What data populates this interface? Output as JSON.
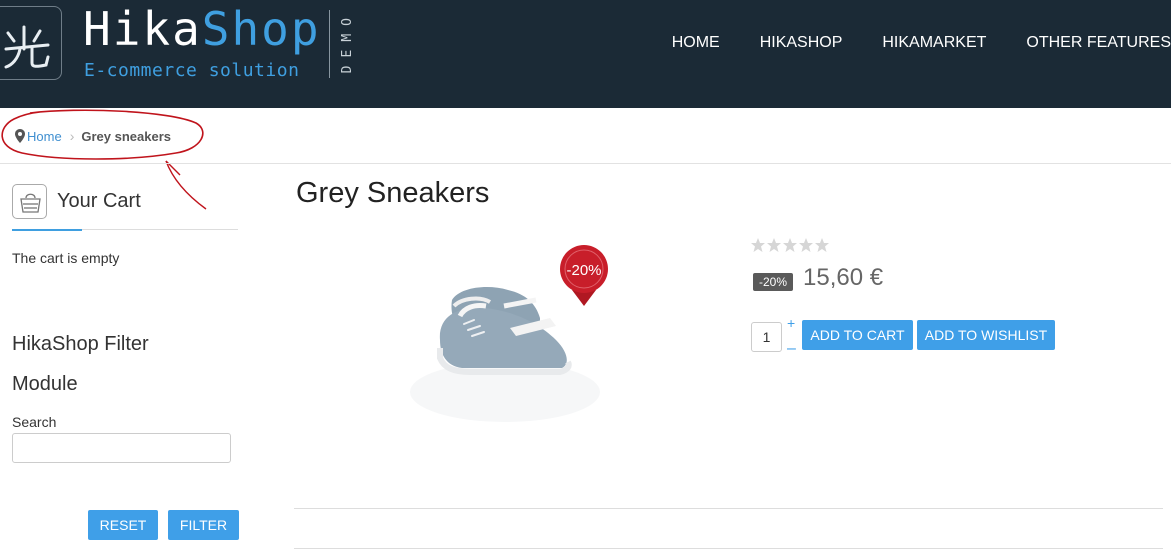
{
  "header": {
    "brand_part1": "Hika",
    "brand_part2": "Shop",
    "tagline": "E-commerce solution",
    "demo_label": "DEMO",
    "nav": [
      "HOME",
      "HIKASHOP",
      "HIKAMARKET",
      "OTHER FEATURES"
    ]
  },
  "breadcrumb": {
    "home": "Home",
    "current": "Grey sneakers"
  },
  "sidebar": {
    "cart_title": "Your Cart",
    "cart_empty": "The cart is empty",
    "filter_title": "HikaShop Filter Module",
    "search_label": "Search",
    "reset_label": "RESET",
    "filter_label": "FILTER"
  },
  "product": {
    "title": "Grey Sneakers",
    "image_badge": "-20%",
    "discount_badge": "-20%",
    "price": "15,60 €",
    "quantity": "1",
    "qty_plus": "+",
    "qty_minus": "–",
    "add_to_cart": "ADD TO CART",
    "add_to_wishlist": "ADD TO WISHLIST",
    "rating_stars": 5,
    "rating_filled": 0
  },
  "colors": {
    "header_bg": "#1b2a36",
    "accent": "#3f9fe0",
    "button": "#3f9fe8",
    "sale_badge": "#c81e2a",
    "annotation": "#c0141c"
  },
  "icons": [
    "hikashop-logo-icon",
    "location-pin-icon",
    "cart-basket-icon",
    "star-icon"
  ]
}
